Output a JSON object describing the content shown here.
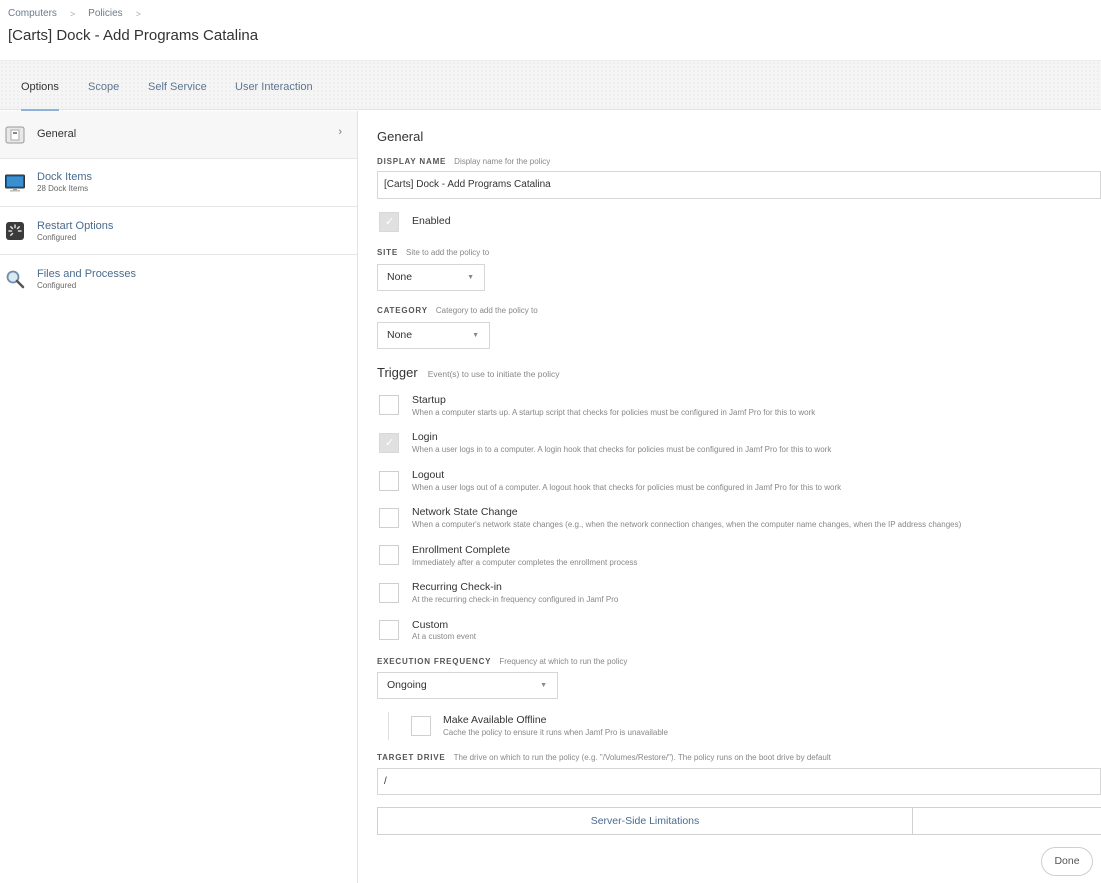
{
  "breadcrumb": {
    "items": [
      "Computers",
      "Policies"
    ],
    "separator": ">"
  },
  "page_title": "[Carts] Dock - Add Programs Catalina",
  "tabs": [
    {
      "label": "Options",
      "active": true
    },
    {
      "label": "Scope",
      "active": false
    },
    {
      "label": "Self Service",
      "active": false
    },
    {
      "label": "User Interaction",
      "active": false
    }
  ],
  "sidebar": {
    "items": [
      {
        "title": "General",
        "subtitle": "",
        "icon": "general-icon",
        "active": true
      },
      {
        "title": "Dock Items",
        "subtitle": "28 Dock Items",
        "icon": "monitor-icon"
      },
      {
        "title": "Restart Options",
        "subtitle": "Configured",
        "icon": "restart-icon"
      },
      {
        "title": "Files and Processes",
        "subtitle": "Configured",
        "icon": "magnifier-icon"
      }
    ]
  },
  "general": {
    "section_title": "General",
    "display_name_label": "DISPLAY NAME",
    "display_name_hint": "Display name for the policy",
    "display_name_value": "[Carts] Dock - Add Programs Catalina",
    "enabled_label": "Enabled",
    "enabled": true,
    "site_label": "SITE",
    "site_hint": "Site to add the policy to",
    "site_value": "None",
    "category_label": "CATEGORY",
    "category_hint": "Category to add the policy to",
    "category_value": "None"
  },
  "trigger": {
    "title": "Trigger",
    "hint": "Event(s) to use to initiate the policy",
    "options": [
      {
        "title": "Startup",
        "desc": "When a computer starts up. A startup script that checks for policies must be configured in Jamf Pro for this to work",
        "checked": false
      },
      {
        "title": "Login",
        "desc": "When a user logs in to a computer. A login hook that checks for policies must be configured in Jamf Pro for this to work",
        "checked": true
      },
      {
        "title": "Logout",
        "desc": "When a user logs out of a computer. A logout hook that checks for policies must be configured in Jamf Pro for this to work",
        "checked": false
      },
      {
        "title": "Network State Change",
        "desc": "When a computer's network state changes (e.g., when the network connection changes, when the computer name changes, when the IP address changes)",
        "checked": false
      },
      {
        "title": "Enrollment Complete",
        "desc": "Immediately after a computer completes the enrollment process",
        "checked": false
      },
      {
        "title": "Recurring Check-in",
        "desc": "At the recurring check-in frequency configured in Jamf Pro",
        "checked": false
      },
      {
        "title": "Custom",
        "desc": "At a custom event",
        "checked": false
      }
    ]
  },
  "execution": {
    "label": "EXECUTION FREQUENCY",
    "hint": "Frequency at which to run the policy",
    "value": "Ongoing",
    "offline_title": "Make Available Offline",
    "offline_desc": "Cache the policy to ensure it runs when Jamf Pro is unavailable",
    "offline_checked": false
  },
  "target_drive": {
    "label": "TARGET DRIVE",
    "hint": "The drive on which to run the policy (e.g. \"/Volumes/Restore/\"). The policy runs on the boot drive by default",
    "value": "/"
  },
  "bottom_tabs": {
    "server_side": "Server-Side Limitations"
  },
  "done_label": "Done",
  "colors": {
    "accent": "#4a6b8f",
    "tab_underline": "#8fb2d8"
  }
}
